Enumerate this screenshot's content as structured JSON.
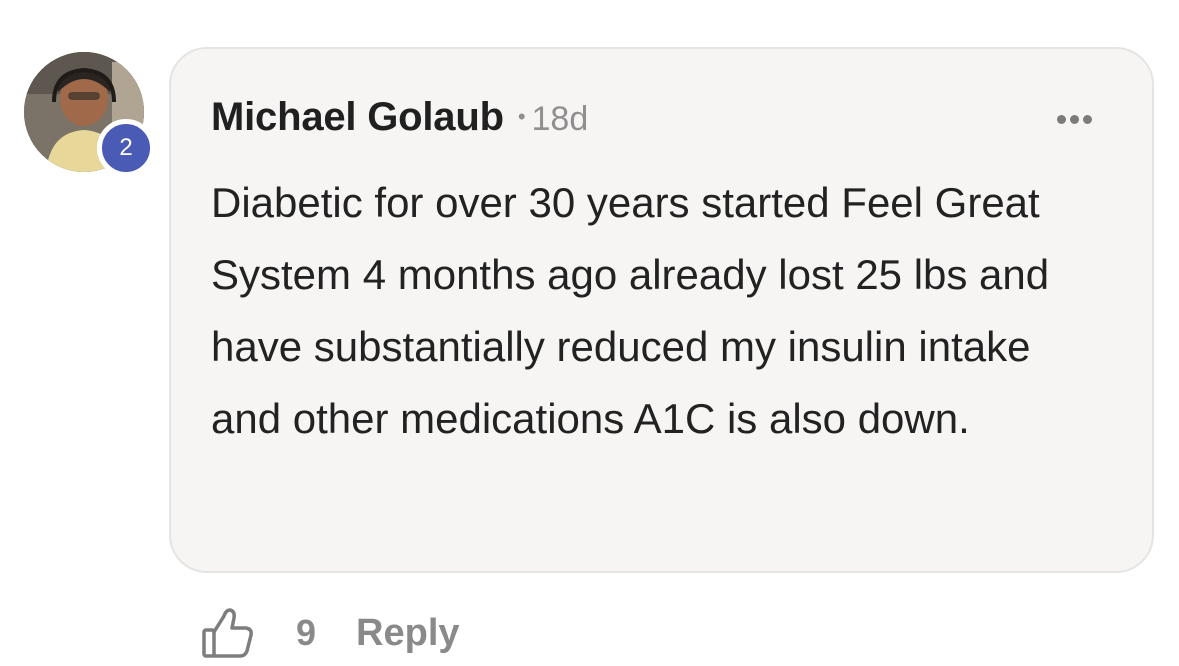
{
  "comment": {
    "author": "Michael Golaub",
    "separator": "•",
    "time": "18d",
    "badge_count": "2",
    "text": "Diabetic for over 30 years started Feel Great System 4 months ago already lost 25 lbs and have substantially reduced my insulin intake and other medications A1C is also down.",
    "like_count": "9",
    "reply_label": "Reply",
    "icons": {
      "more": "more-options-icon",
      "like": "thumbs-up-icon"
    }
  }
}
